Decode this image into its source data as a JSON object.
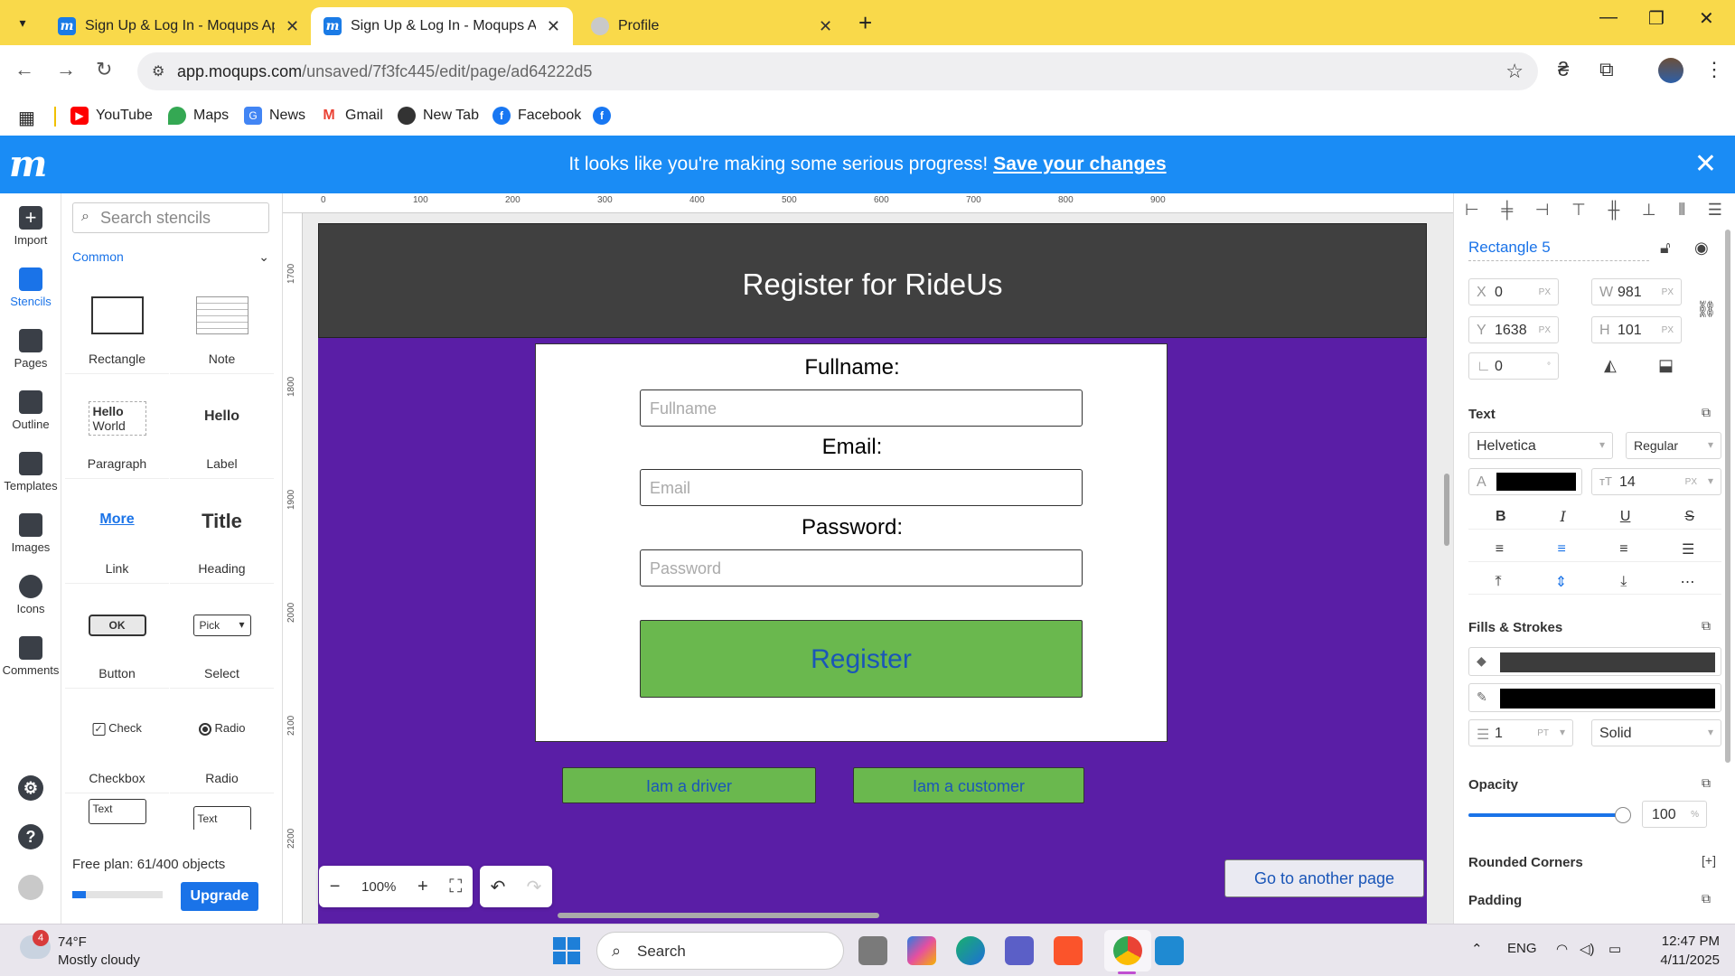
{
  "browser": {
    "tabs": [
      {
        "title": "Sign Up & Log In - Moqups App",
        "icon": "moqups-icon",
        "active": false
      },
      {
        "title": "Sign Up & Log In - Moqups App",
        "icon": "moqups-icon",
        "active": true
      },
      {
        "title": "Profile",
        "icon": "globe-icon",
        "active": false
      }
    ],
    "url_domain": "app.moqups.com",
    "url_path": "/unsaved/7f3fc445/edit/page/ad64222d5",
    "bookmarks": [
      {
        "label": "YouTube",
        "icon": "youtube-icon",
        "color": "#ff0000"
      },
      {
        "label": "Maps",
        "icon": "maps-icon",
        "color": "#34a853"
      },
      {
        "label": "News",
        "icon": "news-icon",
        "color": "#4285f4"
      },
      {
        "label": "Gmail",
        "icon": "gmail-icon",
        "color": "#ea4335"
      },
      {
        "label": "New Tab",
        "icon": "globe-icon",
        "color": "#333333"
      },
      {
        "label": "Facebook",
        "icon": "facebook-icon",
        "color": "#1877f2"
      }
    ]
  },
  "banner": {
    "message": "It looks like you're making some serious progress!",
    "link": "Save your changes",
    "logo": "m"
  },
  "rail": [
    {
      "label": "Import",
      "icon": "plus-icon",
      "active": false
    },
    {
      "label": "Stencils",
      "icon": "shapes-icon",
      "active": true
    },
    {
      "label": "Pages",
      "icon": "pages-icon",
      "active": false
    },
    {
      "label": "Outline",
      "icon": "layers-icon",
      "active": false
    },
    {
      "label": "Templates",
      "icon": "templates-icon",
      "active": false
    },
    {
      "label": "Images",
      "icon": "image-icon",
      "active": false
    },
    {
      "label": "Icons",
      "icon": "club-icon",
      "active": false
    },
    {
      "label": "Comments",
      "icon": "comment-icon",
      "active": false
    }
  ],
  "stencils": {
    "search_placeholder": "Search stencils",
    "category": "Common",
    "items": [
      {
        "label": "Rectangle"
      },
      {
        "label": "Note"
      },
      {
        "label": "Paragraph",
        "sample1": "Hello",
        "sample2": "World"
      },
      {
        "label": "Label",
        "sample": "Hello"
      },
      {
        "label": "Link",
        "sample": "More"
      },
      {
        "label": "Heading",
        "sample": "Title"
      },
      {
        "label": "Button",
        "sample": "OK"
      },
      {
        "label": "Select",
        "sample": "Pick"
      },
      {
        "label": "Checkbox",
        "sample": "Check"
      },
      {
        "label": "Radio",
        "sample": "Radio"
      },
      {
        "sample": "Text"
      },
      {
        "sample": "Text"
      }
    ],
    "plan_text": "Free plan: 61/400 objects",
    "plan_used_fraction": 0.15,
    "upgrade": "Upgrade"
  },
  "canvas": {
    "ruler_top": [
      "0",
      "100",
      "200",
      "300",
      "400",
      "500",
      "600",
      "700",
      "800",
      "900"
    ],
    "ruler_left": [
      "1700",
      "1800",
      "1900",
      "2000",
      "2100",
      "2200"
    ],
    "mockup": {
      "title": "Register for RideUs",
      "fullname_label": "Fullname:",
      "fullname_placeholder": "Fullname",
      "email_label": "Email:",
      "email_placeholder": "Email",
      "password_label": "Password:",
      "password_placeholder": "Password",
      "register": "Register",
      "driver_btn": "Iam a driver",
      "customer_btn": "Iam a customer",
      "goto_btn": "Go to another page",
      "colors": {
        "background": "#5a1ea6",
        "header": "#404040",
        "button": "#6ab84e",
        "button_text": "#1a56b8"
      }
    },
    "zoom": "100%"
  },
  "inspector": {
    "name": "Rectangle 5",
    "x": "0",
    "y": "1638",
    "w": "981",
    "h": "101",
    "rotation": "0",
    "unit_px": "PX",
    "text_section": "Text",
    "font": "Helvetica",
    "weight": "Regular",
    "font_size": "14",
    "text_color": "#000000",
    "fills_section": "Fills & Strokes",
    "fill_color": "#3c3c3c",
    "stroke_color": "#000000",
    "stroke_width": "1",
    "stroke_unit": "PT",
    "stroke_style": "Solid",
    "opacity_section": "Opacity",
    "opacity": "100",
    "opacity_unit": "%",
    "rounded_section": "Rounded Corners",
    "padding_section": "Padding"
  },
  "taskbar": {
    "weather_temp": "74°F",
    "weather_desc": "Mostly cloudy",
    "weather_badge": "4",
    "search": "Search",
    "lang": "ENG",
    "time": "12:47 PM",
    "date": "4/11/2025"
  }
}
